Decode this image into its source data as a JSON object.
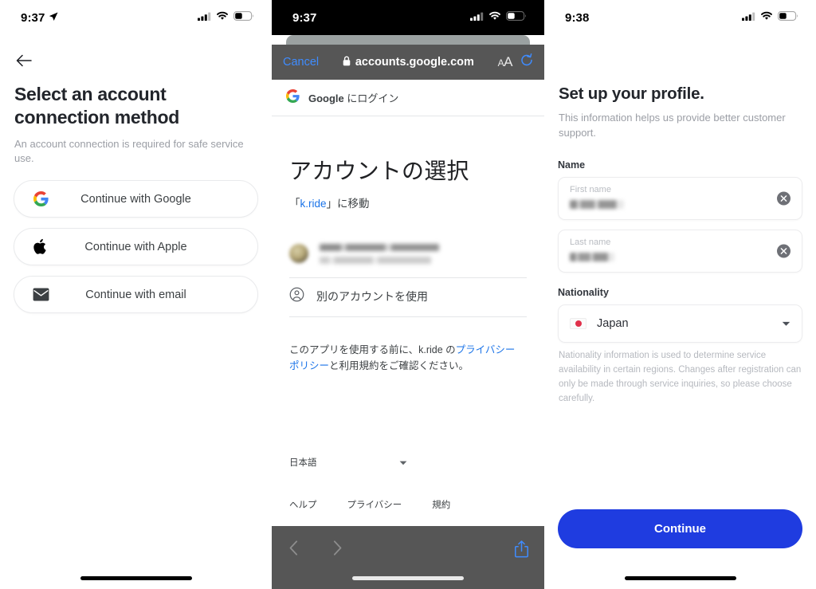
{
  "panel1": {
    "status": {
      "time": "9:37",
      "location_icon": "location-arrow-icon",
      "cellular_icon": "cellular-bars-icon",
      "wifi_icon": "wifi-icon",
      "battery_icon": "battery-low-icon"
    },
    "back_icon": "arrow-left-icon",
    "title": "Select an account connection method",
    "subtitle": "An account connection is required for safe service use.",
    "buttons": [
      {
        "label": "Continue with Google",
        "icon": "google-logo-icon"
      },
      {
        "label": "Continue with Apple",
        "icon": "apple-logo-icon"
      },
      {
        "label": "Continue with email",
        "icon": "envelope-icon"
      }
    ]
  },
  "panel2": {
    "status": {
      "time": "9:37",
      "cellular_icon": "cellular-bars-icon",
      "wifi_icon": "wifi-icon",
      "battery_icon": "battery-low-icon"
    },
    "browser": {
      "cancel_label": "Cancel",
      "lock_icon": "lock-icon",
      "url": "accounts.google.com",
      "text_size_label": "AA",
      "reload_icon": "reload-icon",
      "back_icon": "chevron-left-icon",
      "forward_icon": "chevron-right-icon",
      "share_icon": "share-icon"
    },
    "site_header": {
      "logo": "google-logo-icon",
      "brand": "Google",
      "text": " にログイン"
    },
    "content": {
      "title": "アカウントの選択",
      "subtitle_prefix": "「",
      "subtitle_link": "k.ride",
      "subtitle_suffix": "」に移動",
      "account_row_redacted": true,
      "other_account": {
        "icon": "account-circle-icon",
        "label": "別のアカウントを使用"
      },
      "legal_prefix": "このアプリを使用する前に、k.ride の",
      "legal_link": "プライバシー ポリシー",
      "legal_suffix": "と利用規約をご確認ください。",
      "language": "日本語",
      "language_caret_icon": "caret-down-icon",
      "footer_links": [
        "ヘルプ",
        "プライバシー",
        "規約"
      ]
    }
  },
  "panel3": {
    "status": {
      "time": "9:38",
      "cellular_icon": "cellular-bars-icon",
      "wifi_icon": "wifi-icon",
      "battery_icon": "battery-low-icon"
    },
    "title": "Set up your profile.",
    "subtitle": "This information helps us provide better customer support.",
    "name_section_label": "Name",
    "first_name": {
      "placeholder": "First name",
      "value_redacted": true,
      "clear_icon": "clear-circle-icon"
    },
    "last_name": {
      "placeholder": "Last name",
      "value_redacted": true,
      "clear_icon": "clear-circle-icon"
    },
    "nationality_label": "Nationality",
    "nationality_value": "Japan",
    "nationality_flag_icon": "japan-flag-icon",
    "nationality_caret_icon": "caret-down-icon",
    "nationality_helper": "Nationality information is used to determine service availability in certain regions. Changes after registration can only be made through service inquiries, so please choose carefully.",
    "continue_label": "Continue"
  },
  "colors": {
    "primary_blue": "#1f3ce0",
    "link_blue": "#1a73e8",
    "safari_blue": "#3f8cff",
    "toolbar_gray": "#565656",
    "tab_gray": "#9ba1a1"
  }
}
